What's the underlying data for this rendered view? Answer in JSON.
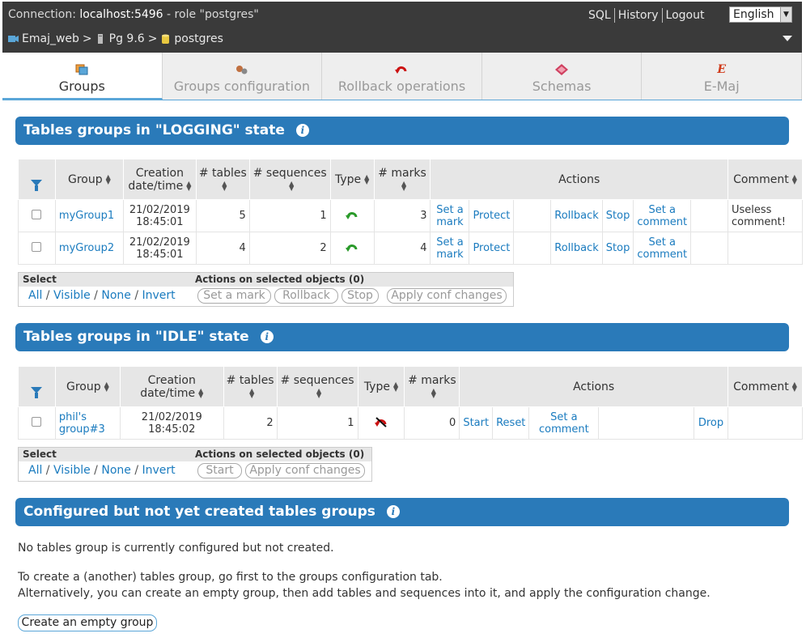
{
  "topbar": {
    "connection_label": "Connection:",
    "connection_value": "localhost:5496",
    "role_text": "- role \"postgres\"",
    "links": [
      "SQL",
      "History",
      "Logout"
    ],
    "language": "English",
    "breadcrumb": [
      "Emaj_web",
      ">",
      "Pg 9.6",
      ">",
      "postgres"
    ]
  },
  "tabs": [
    {
      "label": "Groups",
      "icon": "groups-icon"
    },
    {
      "label": "Groups configuration",
      "icon": "config-icon"
    },
    {
      "label": "Rollback operations",
      "icon": "rollback-icon"
    },
    {
      "label": "Schemas",
      "icon": "schemas-icon"
    },
    {
      "label": "E-Maj",
      "icon": "emaj-icon"
    }
  ],
  "logging": {
    "title": "Tables groups in \"LOGGING\" state",
    "headers": {
      "group": "Group",
      "creation": "Creation date/time",
      "tables": "# tables",
      "sequences": "# sequences",
      "type": "Type",
      "marks": "# marks",
      "actions": "Actions",
      "comment": "Comment"
    },
    "rows": [
      {
        "group": "myGroup1",
        "date": "21/02/2019",
        "time": "18:45:01",
        "tables": "5",
        "sequences": "1",
        "marks": "3",
        "a1": "Set a mark",
        "a2": "Protect",
        "a3": "Rollback",
        "a4": "Stop",
        "a5": "Set a comment",
        "comment": "Useless comment!"
      },
      {
        "group": "myGroup2",
        "date": "21/02/2019",
        "time": "18:45:01",
        "tables": "4",
        "sequences": "2",
        "marks": "4",
        "a1": "Set a mark",
        "a2": "Protect",
        "a3": "Rollback",
        "a4": "Stop",
        "a5": "Set a comment",
        "comment": ""
      }
    ],
    "select_label": "Select",
    "actions_label": "Actions on selected objects (0)",
    "select_links": [
      "All",
      "Visible",
      "None",
      "Invert"
    ],
    "buttons": [
      "Set a mark",
      "Rollback",
      "Stop",
      "Apply conf changes"
    ]
  },
  "idle": {
    "title": "Tables groups in \"IDLE\" state",
    "headers": {
      "group": "Group",
      "creation": "Creation date/time",
      "tables": "# tables",
      "sequences": "# sequences",
      "type": "Type",
      "marks": "# marks",
      "actions": "Actions",
      "comment": "Comment"
    },
    "rows": [
      {
        "group": "phil's group#3",
        "date": "21/02/2019",
        "time": "18:45:02",
        "tables": "2",
        "sequences": "1",
        "marks": "0",
        "a1": "Start",
        "a2": "Reset",
        "a3": "Set a comment",
        "a4": "Drop",
        "comment": ""
      }
    ],
    "select_label": "Select",
    "actions_label": "Actions on selected objects (0)",
    "select_links": [
      "All",
      "Visible",
      "None",
      "Invert"
    ],
    "buttons": [
      "Start",
      "Apply conf changes"
    ]
  },
  "configured": {
    "title": "Configured but not yet created tables groups",
    "none_text": "No tables group is currently configured but not created.",
    "hint1": "To create a (another) tables group, go first to the groups configuration tab.",
    "hint2": "Alternatively, you can create an empty group, then add tables and sequences into it, and apply the configuration change.",
    "create_button": "Create an empty group"
  },
  "colors": {
    "accent": "#2a7ab9",
    "link": "#1a7bbf",
    "rollbackable": "#2a9a2a",
    "audit_only": "#cc1111"
  }
}
